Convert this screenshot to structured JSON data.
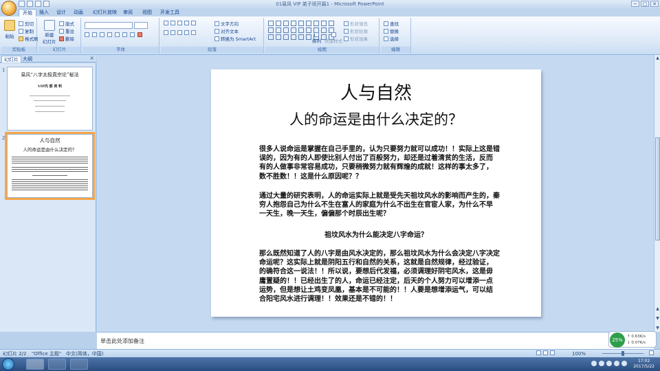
{
  "window": {
    "title": "01易风 VIP 弟子班开篇1 - Microsoft PowerPoint",
    "controls": [
      "─",
      "□",
      "✕"
    ]
  },
  "tabs": [
    "开始",
    "插入",
    "设计",
    "动画",
    "幻灯片放映",
    "审阅",
    "视图",
    "开发工具"
  ],
  "ribbon": {
    "clipboard": {
      "paste": "粘贴",
      "cut": "剪切",
      "copy": "复制",
      "format_painter": "格式刷",
      "label": "剪贴板"
    },
    "slides": {
      "new_slide": "新建",
      "new_slide2": "幻灯片",
      "layout": "版式",
      "reset": "重设",
      "delete": "删除",
      "label": "幻灯片"
    },
    "font": {
      "label": "字体"
    },
    "paragraph": {
      "text_direction": "文字方向",
      "align_text": "对齐文本",
      "smartart": "转换为 SmartArt",
      "label": "段落"
    },
    "drawing": {
      "arrange": "排列",
      "quick_styles": "快速样式",
      "shape_fill": "形状填充",
      "shape_outline": "形状轮廓",
      "shape_effects": "形状效果",
      "label": "绘图"
    },
    "editing": {
      "find": "查找",
      "replace": "替换",
      "select": "选择",
      "label": "编辑"
    }
  },
  "left_panel": {
    "tab_slides": "幻灯片",
    "tab_outline": "大纲",
    "close": "×",
    "slide1": {
      "number": "1",
      "title": "易风“八字太极真宗论”秘法",
      "subtitle": "VIP内 部 资 料"
    },
    "slide2": {
      "number": "2",
      "title": "人与自然",
      "subtitle": "人的命运是由什么决定的？"
    }
  },
  "slide": {
    "title": "人与自然",
    "subtitle": "人的命运是由什么决定的？",
    "para1": "很多人说命运是掌握在自己手里的，认为只要努力就可以成功！！实际上这是错\n误的，因为有的人即使比别人付出了百般努力，却还是过着清贫的生活，反而\n有的人做事非常容易成功，只要稍微努力就有辉煌的成就！这样的事太多了，\n数不胜数！！这是什么原因呢？？",
    "para2": "通过大量的研究表明，人的命运实际上就是受先天祖坟风水的影响而产生的，秦\n穷人抱怨自己为什么不生在富人的家庭为什么不出生在官宦人家，为什么不早\n一天生，晚一天生，偏偏那个时辰出生呢？",
    "heading": "祖坟风水为什么能决定八字命运？",
    "para3": "那么既然知道了人的八字是由风水决定的，那么祖坟风水为什么会决定八字决定\n命运呢？这实际上就是阴阳五行和自然的关系，这就是自然规律，经过验证，\n的确符合这一说法！！所以说，要想后代发福，必须调理好阴宅风水，这是毋\n庸置疑的！！已经出生了的人，命运已经注定，后天的个人努力可以增添一点\n运势，但是想让土鸡变凤凰，基本是不可能的！！人要是想增添运气，可以结\n合阳宅风水进行调理！！效果还是不错的！！"
  },
  "notes": {
    "placeholder": "单击此处添加备注"
  },
  "netmon": {
    "percent": "25%",
    "up": "0.63K/s",
    "down": "0.07K/s"
  },
  "status": {
    "slide_count": "幻灯片 2/2",
    "theme": "\"Office 主题\"",
    "language": "中文(简体，中国)",
    "zoom": "100%"
  },
  "taskbar": {
    "time": "17:02",
    "date": "2017/5/22"
  }
}
